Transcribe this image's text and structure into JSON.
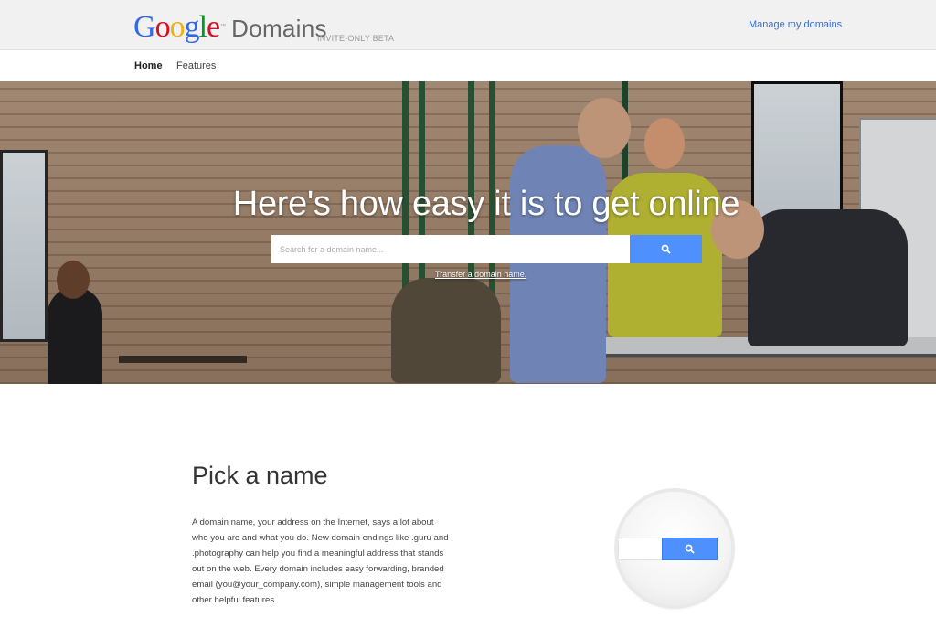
{
  "header": {
    "logo_google": [
      "G",
      "o",
      "o",
      "g",
      "l",
      "e"
    ],
    "logo_colors": [
      "#3369e8",
      "#d50f25",
      "#eeb211",
      "#3369e8",
      "#009925",
      "#d50f25"
    ],
    "logo_tm": "™",
    "logo_domains": "Domains",
    "beta": "INVITE-ONLY BETA",
    "manage_link": "Manage my domains"
  },
  "nav": {
    "home": "Home",
    "features": "Features"
  },
  "hero": {
    "title": "Here's how easy it is to get online",
    "search_placeholder": "Search for a domain name...",
    "search_icon": "search-icon",
    "transfer_link": "Transfer a domain name."
  },
  "pick": {
    "title": "Pick a name",
    "text": "A domain name, your address on the Internet, says a lot about who you are and what you do. New domain endings like .guru and .photography can help you find a meaningful address that stands out on the web. Every domain includes easy forwarding, branded email (you@your_company.com), simple management tools and other helpful features."
  },
  "colors": {
    "accent": "#4d90fe",
    "link": "#3a6ec5",
    "header_bg": "#f1f1f1"
  }
}
